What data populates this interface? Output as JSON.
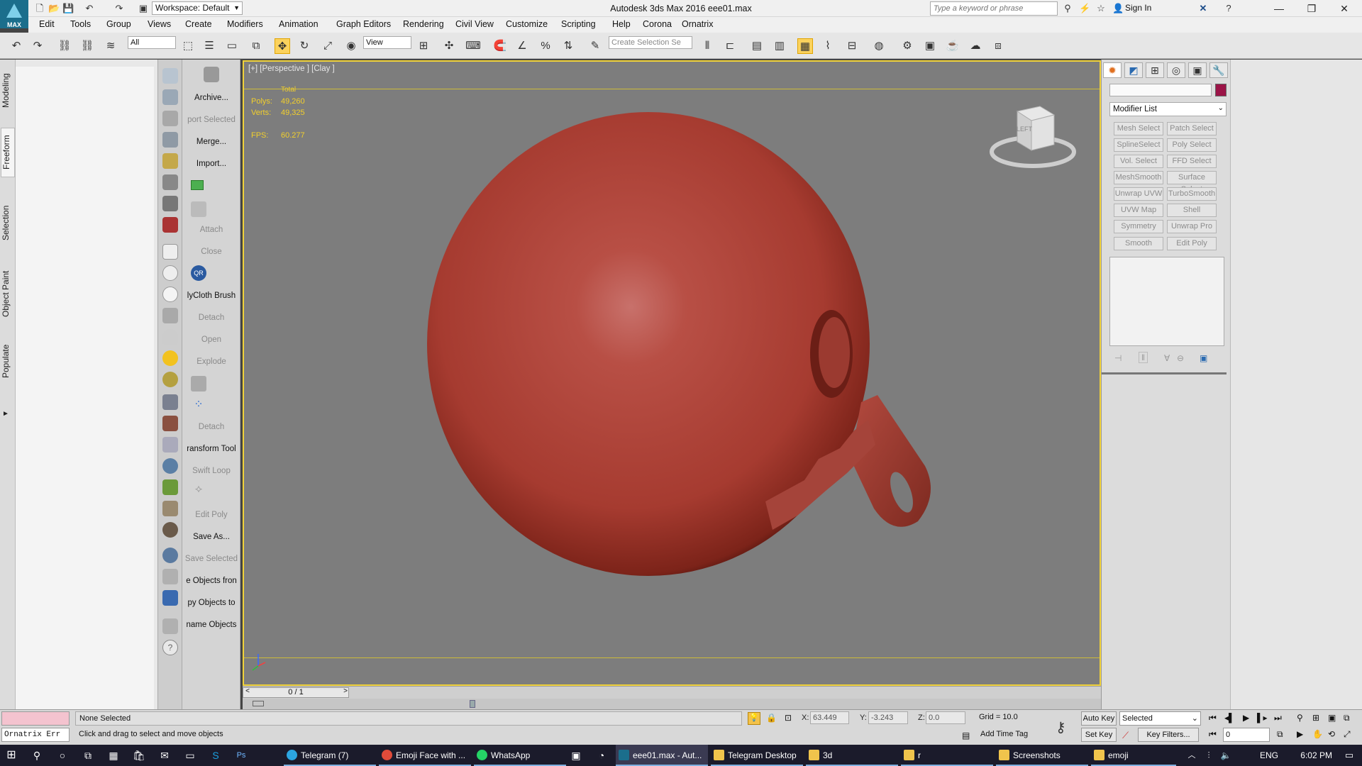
{
  "titlebar": {
    "workspace": "Workspace: Default",
    "app_title": "Autodesk 3ds Max 2016      eee01.max",
    "search_placeholder": "Type a keyword or phrase",
    "sign_in": "Sign In"
  },
  "menu": [
    "Edit",
    "Tools",
    "Group",
    "Views",
    "Create",
    "Modifiers",
    "Animation",
    "Graph Editors",
    "Rendering",
    "Civil View",
    "Customize",
    "Scripting",
    "Help",
    "Corona",
    "Ornatrix"
  ],
  "toolbar": {
    "selection_filter": "All",
    "ref_coord": "View",
    "named_selection_placeholder": "Create Selection Se"
  },
  "ribbon_tabs": [
    "Modeling",
    "Freeform",
    "Selection",
    "Object Paint",
    "Populate"
  ],
  "command_names": {
    "archive": "Archive...",
    "export_selected": "port Selected",
    "merge": "Merge...",
    "import": "Import...",
    "attach": "Attach",
    "close": "Close",
    "polycloth": "lyCloth Brush",
    "detach1": "Detach",
    "open": "Open",
    "explode": "Explode",
    "detach2": "Detach",
    "transform_tool": "ransform Tool",
    "swift_loop": "Swift Loop",
    "edit_poly": "Edit Poly",
    "save_as": "Save As...",
    "save_selected": "Save Selected",
    "objects_from": "e Objects fron",
    "copy_objects_to": "py Objects to",
    "rename_objects": "name Objects"
  },
  "viewport": {
    "label": "[+] [Perspective ] [Clay ]",
    "stats_header": "Total",
    "polys_label": "Polys:",
    "polys": "49,260",
    "verts_label": "Verts:",
    "verts": "49,325",
    "fps_label": "FPS:",
    "fps": "60.277",
    "viewcube_face": "LEFT",
    "object_color": "#b0453a"
  },
  "timeslider": {
    "frame": "0 / 1"
  },
  "command_panel": {
    "modifier_list": "Modifier List",
    "object_color": "#9b1447",
    "buttons": [
      [
        "Mesh Select",
        "Patch Select"
      ],
      [
        "SplineSelect",
        "Poly Select"
      ],
      [
        "Vol. Select",
        "FFD Select"
      ],
      [
        "MeshSmooth",
        "Surface Select"
      ],
      [
        "Unwrap UVW",
        "TurboSmooth"
      ],
      [
        "UVW Map",
        "Shell"
      ],
      [
        "Symmetry",
        "Unwrap Pro"
      ],
      [
        "Smooth",
        "Edit Poly"
      ]
    ]
  },
  "statusbar": {
    "maxscript_text": "Ornatrix Err",
    "selection": "None Selected",
    "prompt": "Click and drag to select and move objects",
    "x_label": "X:",
    "x": "63.449",
    "y_label": "Y:",
    "y": "-3.243",
    "z_label": "Z:",
    "z": "0.0",
    "grid": "Grid = 10.0",
    "add_time_tag": "Add Time Tag",
    "auto_key": "Auto Key",
    "set_key": "Set Key",
    "selected": "Selected",
    "key_filters": "Key Filters...",
    "frame_field": "0"
  },
  "taskbar": {
    "items": [
      "Telegram (7)",
      "Emoji Face with ...",
      "WhatsApp",
      "eee01.max - Aut...",
      "Telegram Desktop",
      "3d",
      "r",
      "Screenshots",
      "emoji"
    ],
    "lang": "ENG",
    "time": "6:02 PM"
  }
}
